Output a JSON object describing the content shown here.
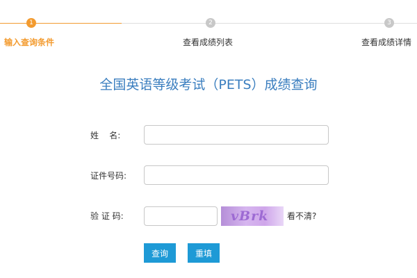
{
  "steps": [
    {
      "number": "1",
      "label": "输入查询条件",
      "state": "active"
    },
    {
      "number": "2",
      "label": "查看成绩列表",
      "state": "inactive"
    },
    {
      "number": "3",
      "label": "查看成绩详情",
      "state": "inactive"
    }
  ],
  "title": "全国英语等级考试（PETS）成绩查询",
  "form": {
    "name_label": "姓    名:",
    "name_value": "",
    "id_label": "证件号码:",
    "id_value": "",
    "captcha_label": "验 证 码:",
    "captcha_value": "",
    "captcha_image_text": "vBrk",
    "refresh_label": "看不清?"
  },
  "buttons": {
    "query": "查询",
    "reset": "重填"
  },
  "colors": {
    "accent_orange": "#f39b2f",
    "title_blue": "#3a7ebf",
    "button_blue": "#1e9ad6",
    "inactive_gray": "#c8c8c8"
  }
}
